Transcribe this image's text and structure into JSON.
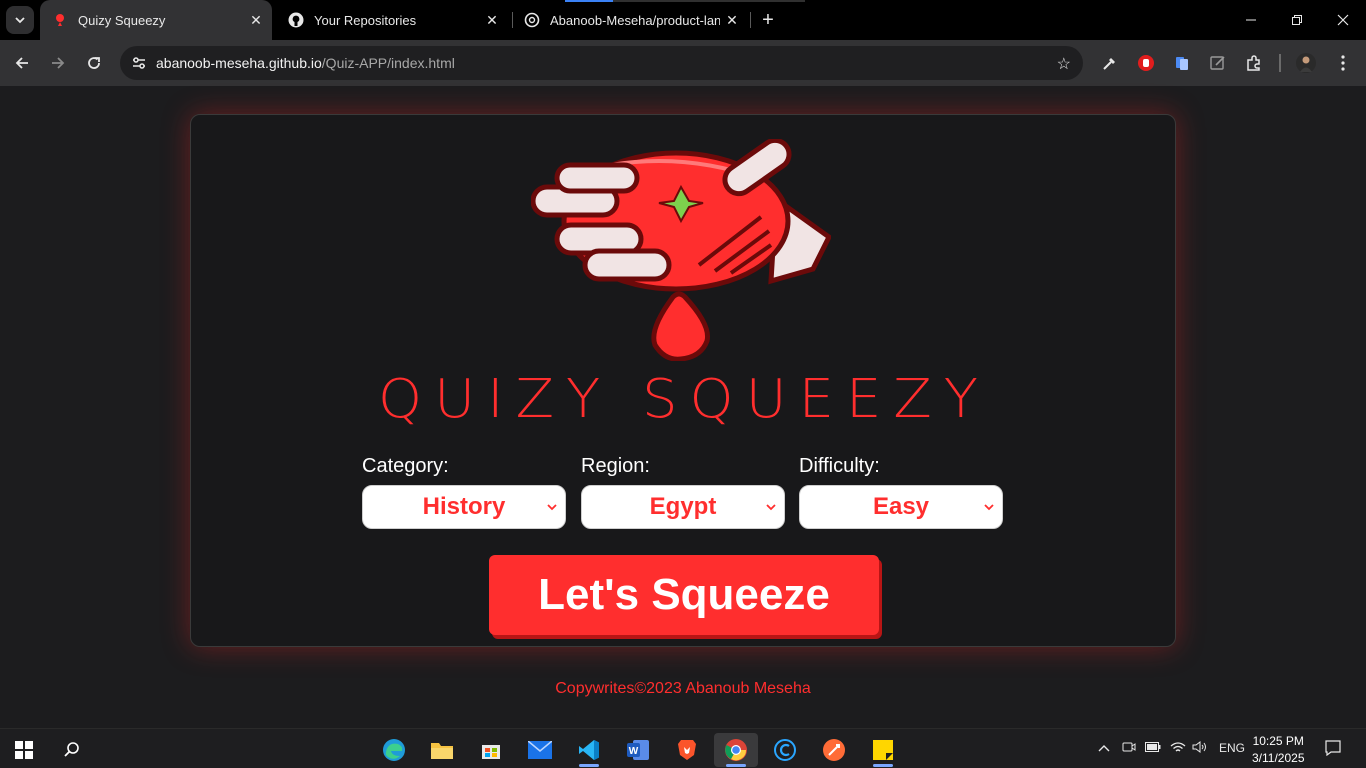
{
  "browser": {
    "tabs": [
      {
        "title": "Quizy Squeezy",
        "active": true
      },
      {
        "title": "Your Repositories",
        "active": false
      },
      {
        "title": "Abanoob-Meseha/product-land",
        "active": false
      }
    ],
    "url_host": "abanoob-meseha.github.io",
    "url_path": "/Quiz-APP/index.html"
  },
  "page": {
    "brand": "QUIZY SQUEEZY",
    "fields": [
      {
        "label": "Category:",
        "value": "History"
      },
      {
        "label": "Region:",
        "value": "Egypt"
      },
      {
        "label": "Difficulty:",
        "value": "Easy"
      }
    ],
    "cta": "Let's Squeeze",
    "footer": "Copywrites©2023 Abanoub Meseha",
    "accent": "#ff2e2e"
  },
  "taskbar": {
    "lang": "ENG",
    "time": "10:25 PM",
    "date": "3/11/2025"
  }
}
